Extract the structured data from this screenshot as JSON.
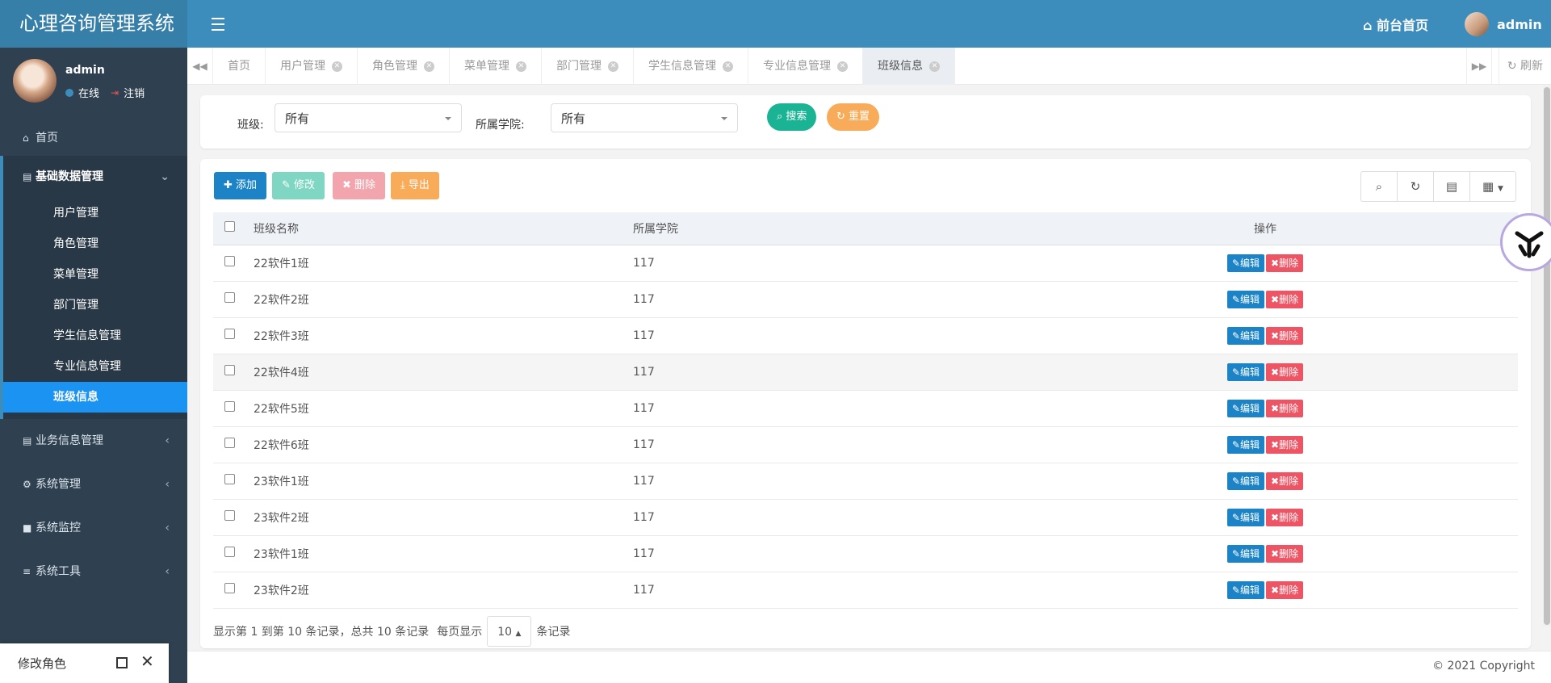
{
  "app_title": "心理咨询管理系统",
  "header": {
    "home_link": "前台首页",
    "username": "admin"
  },
  "sidebar": {
    "user": {
      "name": "admin",
      "status": "在线",
      "logout": "注销"
    },
    "home": "首页",
    "groups": [
      {
        "label": "基础数据管理",
        "expanded": true,
        "items": [
          "用户管理",
          "角色管理",
          "菜单管理",
          "部门管理",
          "学生信息管理",
          "专业信息管理",
          "班级信息"
        ],
        "active": "班级信息"
      },
      {
        "label": "业务信息管理"
      },
      {
        "label": "系统管理"
      },
      {
        "label": "系统监控"
      },
      {
        "label": "系统工具"
      }
    ]
  },
  "tabs": {
    "items": [
      "首页",
      "用户管理",
      "角色管理",
      "菜单管理",
      "部门管理",
      "学生信息管理",
      "专业信息管理",
      "班级信息"
    ],
    "active": "班级信息",
    "refresh": "刷新"
  },
  "search": {
    "class_label": "班级:",
    "class_value": "所有",
    "college_label": "所属学院:",
    "college_value": "所有",
    "search_btn": "搜索",
    "reset_btn": "重置"
  },
  "toolbar": {
    "add": "添加",
    "edit": "修改",
    "delete": "删除",
    "export": "导出"
  },
  "table": {
    "columns": [
      "班级名称",
      "所属学院",
      "操作"
    ],
    "rows": [
      {
        "name": "22软件1班",
        "college": "117"
      },
      {
        "name": "22软件2班",
        "college": "117"
      },
      {
        "name": "22软件3班",
        "college": "117"
      },
      {
        "name": "22软件4班",
        "college": "117"
      },
      {
        "name": "22软件5班",
        "college": "117"
      },
      {
        "name": "22软件6班",
        "college": "117"
      },
      {
        "name": "23软件1班",
        "college": "117"
      },
      {
        "name": "23软件2班",
        "college": "117"
      },
      {
        "name": "23软件1班",
        "college": "117"
      },
      {
        "name": "23软件2班",
        "college": "117"
      }
    ],
    "row_edit": "编辑",
    "row_delete": "删除"
  },
  "pager": {
    "summary": "显示第 1 到第 10 条记录，总共 10 条记录",
    "per_page_label": "每页显示",
    "page_size": "10",
    "records_label": "条记录"
  },
  "footer": {
    "copyright": "© 2021 Copyright"
  },
  "mini_window": {
    "title": "修改角色"
  },
  "colors": {
    "header": "#3c8dbc",
    "sidebar": "#2f4050",
    "active": "#1a93f3",
    "add": "#1c84c6",
    "edit": "#7fd6c3",
    "delete": "#f2a5ac",
    "export": "#f8ac59",
    "search": "#1ab394",
    "reset": "#f8ac59"
  }
}
